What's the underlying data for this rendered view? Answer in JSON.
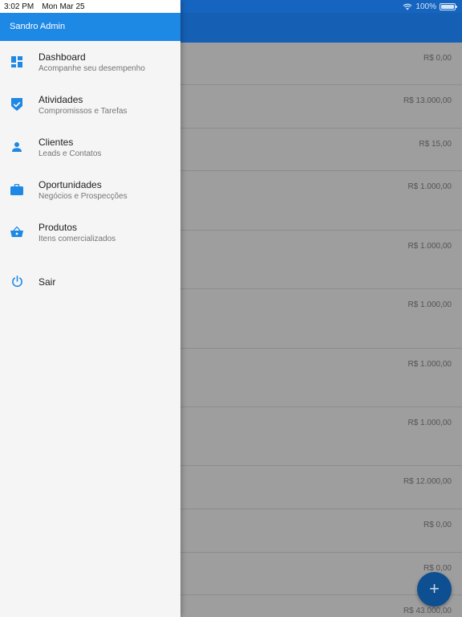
{
  "status_bar": {
    "time": "3:02 PM",
    "date": "Mon Mar 25",
    "battery": "100%",
    "battery_level": 1.0
  },
  "drawer": {
    "user_name": "Sandro Admin",
    "menu": [
      {
        "title": "Dashboard",
        "subtitle": "Acompanhe seu desempenho",
        "icon": "dashboard-icon"
      },
      {
        "title": "Atividades",
        "subtitle": "Compromissos e Tarefas",
        "icon": "shield-check-icon"
      },
      {
        "title": "Clientes",
        "subtitle": "Leads e Contatos",
        "icon": "person-icon"
      },
      {
        "title": "Oportunidades",
        "subtitle": "Negócios e Prospecções",
        "icon": "briefcase-icon"
      },
      {
        "title": "Produtos",
        "subtitle": "Itens comercializados",
        "icon": "basket-icon"
      },
      {
        "title": "Sair",
        "subtitle": "",
        "icon": "power-icon"
      }
    ]
  },
  "background_list": {
    "items": [
      {
        "value": "R$ 0,00"
      },
      {
        "value": "R$ 13.000,00"
      },
      {
        "value": "R$ 15,00"
      },
      {
        "value": "R$ 1.000,00"
      },
      {
        "value": "R$ 1.000,00"
      },
      {
        "value": "R$ 1.000,00"
      },
      {
        "value": "R$ 1.000,00"
      },
      {
        "value": "R$ 1.000,00"
      },
      {
        "value": "R$ 12.000,00"
      },
      {
        "value": "R$ 0,00"
      },
      {
        "value": "R$ 0,00"
      },
      {
        "value": "R$ 43.000,00"
      }
    ]
  },
  "fab": {
    "label": "+",
    "icon": "plus-icon"
  },
  "colors": {
    "drawer_header": "#1e88e5",
    "icon_accent": "#1e88e5",
    "app_bar": "#1565c0",
    "scrim_background": "#9e9e9e"
  }
}
